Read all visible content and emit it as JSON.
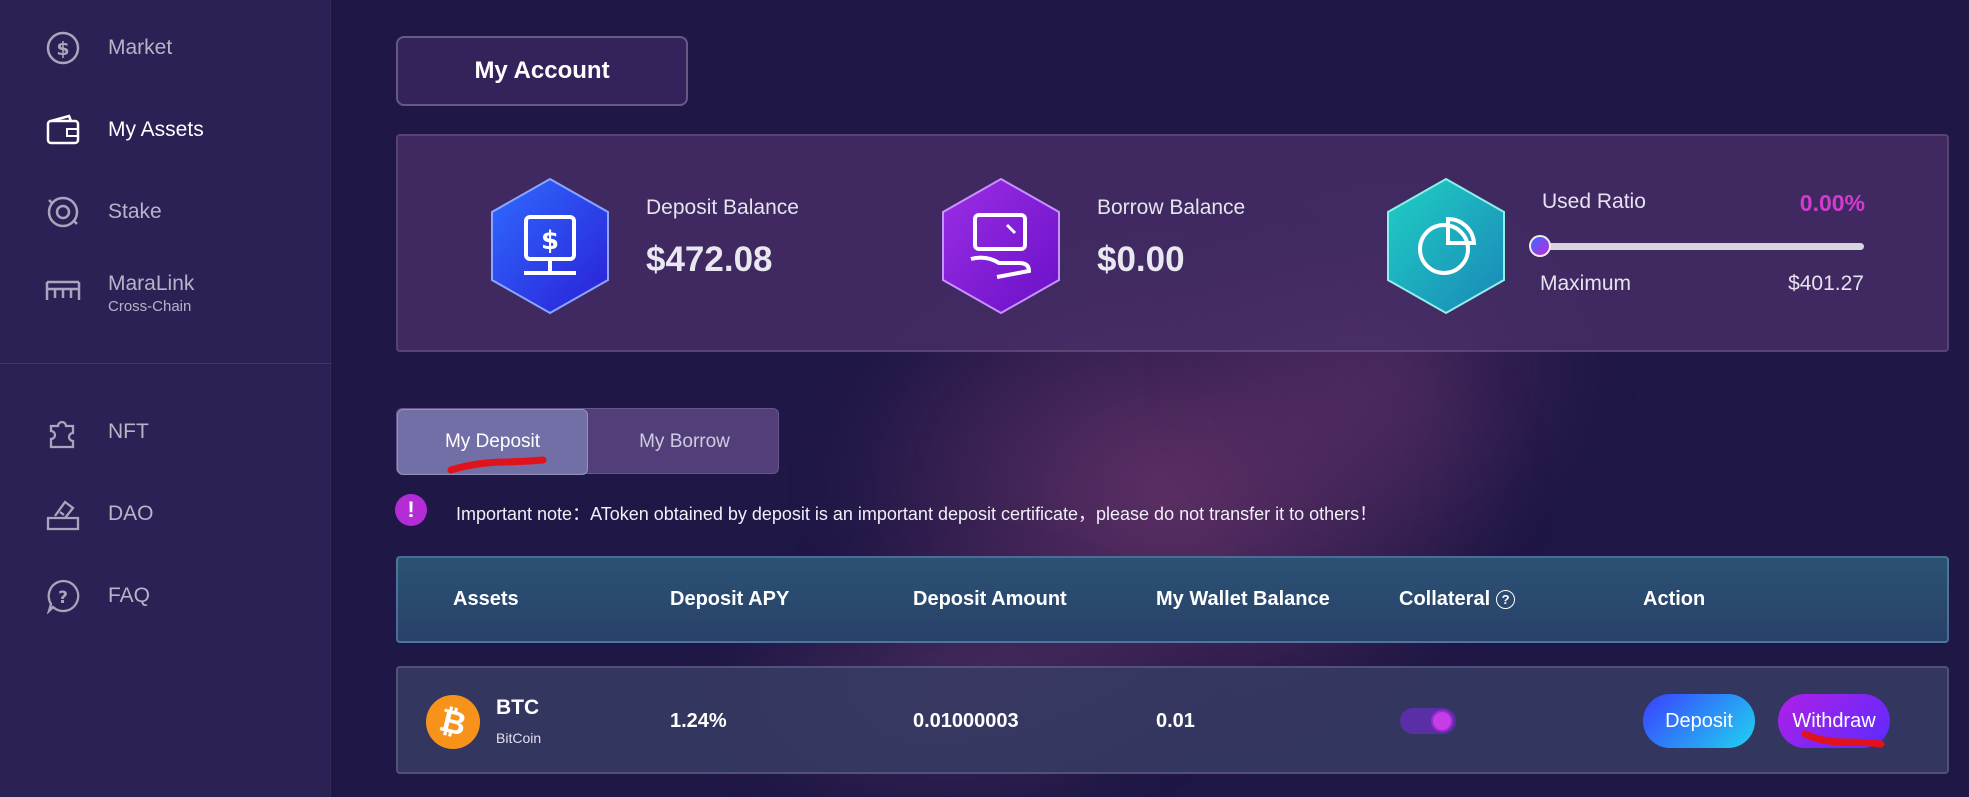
{
  "sidebar": {
    "items": [
      {
        "label": "Market",
        "icon": "dollar-circle-icon"
      },
      {
        "label": "My Assets",
        "icon": "wallet-icon",
        "active": true
      },
      {
        "label": "Stake",
        "icon": "stake-icon"
      },
      {
        "label": "MaraLink",
        "sublabel": "Cross-Chain",
        "icon": "bridge-icon"
      },
      {
        "label": "NFT",
        "icon": "puzzle-icon"
      },
      {
        "label": "DAO",
        "icon": "vote-icon"
      },
      {
        "label": "FAQ",
        "icon": "question-bubble-icon"
      }
    ]
  },
  "header": {
    "title": "My Account"
  },
  "summary": {
    "deposit": {
      "label": "Deposit Balance",
      "value": "$472.08",
      "icon": "deposit-safe-icon"
    },
    "borrow": {
      "label": "Borrow Balance",
      "value": "$0.00",
      "icon": "borrow-hand-icon"
    },
    "ratio": {
      "label": "Used Ratio",
      "value": "0.00%",
      "fraction": 0.0,
      "max_label": "Maximum",
      "max_value": "$401.27",
      "icon": "pie-chart-icon"
    }
  },
  "tabs": [
    {
      "label": "My Deposit",
      "active": true
    },
    {
      "label": "My Borrow",
      "active": false
    }
  ],
  "note": {
    "text": "Important note：AToken obtained by deposit is an important deposit certificate，please do not transfer it to others！"
  },
  "table": {
    "headers": [
      "Assets",
      "Deposit APY",
      "Deposit Amount",
      "My Wallet Balance",
      "Collateral",
      "Action"
    ],
    "rows": [
      {
        "symbol": "BTC",
        "name": "BitCoin",
        "apy": "1.24%",
        "amount": "0.01000003",
        "wallet": "0.01",
        "collateral": true,
        "deposit_label": "Deposit",
        "withdraw_label": "Withdraw"
      }
    ]
  },
  "colors": {
    "background": "#1f1746",
    "sidebar": "#2c2154",
    "accent_pink": "#d23bd0",
    "deposit_blue": "#2f3cf0",
    "borrow_purple": "#8a1fd8",
    "ratio_teal": "#17b6b8"
  }
}
